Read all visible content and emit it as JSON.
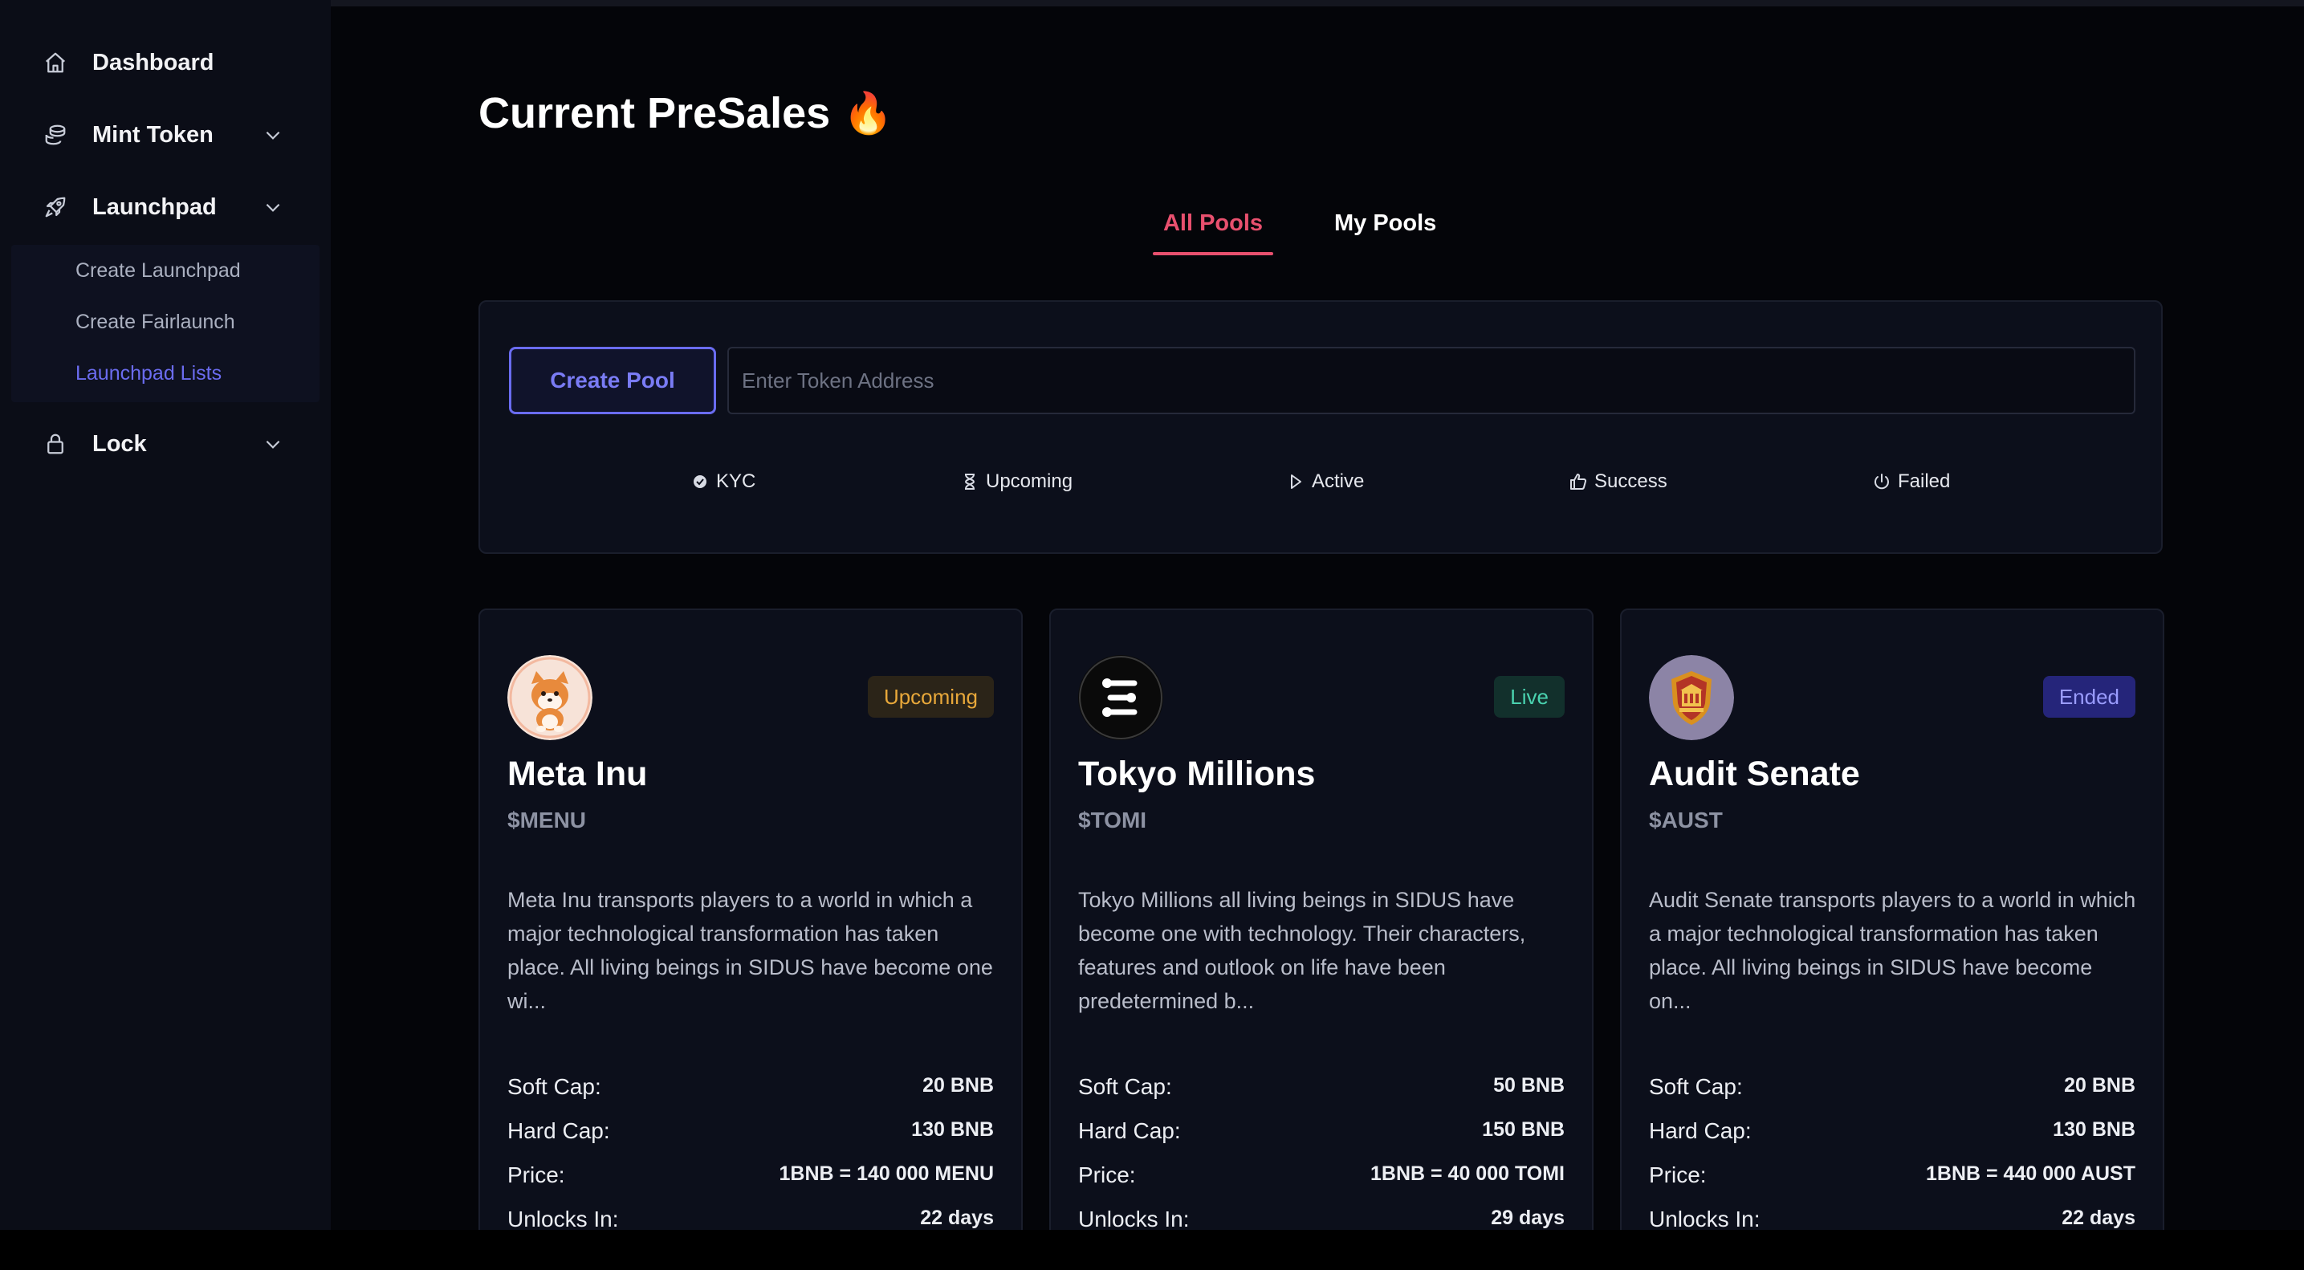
{
  "sidebar": {
    "items": [
      {
        "label": "Dashboard"
      },
      {
        "label": "Mint Token"
      },
      {
        "label": "Launchpad"
      },
      {
        "label": "Lock"
      }
    ],
    "launchpad_submenu": [
      {
        "label": "Create Launchpad"
      },
      {
        "label": "Create Fairlaunch"
      },
      {
        "label": "Launchpad Lists",
        "active": true
      }
    ]
  },
  "page": {
    "title": "Current PreSales",
    "title_emoji": "🔥"
  },
  "tabs": [
    {
      "label": "All Pools",
      "active": true
    },
    {
      "label": "My Pools",
      "active": false
    }
  ],
  "toolbar": {
    "create_pool_label": "Create Pool",
    "token_input_placeholder": "Enter Token Address",
    "token_input_value": ""
  },
  "filters": [
    {
      "label": "KYC",
      "icon": "kyc-icon"
    },
    {
      "label": "Upcoming",
      "icon": "hourglass-icon"
    },
    {
      "label": "Active",
      "icon": "play-icon"
    },
    {
      "label": "Success",
      "icon": "thumbs-up-icon"
    },
    {
      "label": "Failed",
      "icon": "power-icon"
    }
  ],
  "pools": [
    {
      "name": "Meta Inu",
      "symbol": "$MENU",
      "status": "Upcoming",
      "logo_icon": "shiba-logo",
      "description": "Meta Inu transports players to a world in which a major technological transformation has taken place. All living beings in SIDUS have become one wi...",
      "stats": [
        {
          "label": "Soft Cap:",
          "value": "20 BNB"
        },
        {
          "label": "Hard Cap:",
          "value": "130 BNB"
        },
        {
          "label": "Price:",
          "value": "1BNB = 140 000 MENU"
        },
        {
          "label": "Unlocks In:",
          "value": "22 days"
        }
      ]
    },
    {
      "name": "Tokyo Millions",
      "symbol": "$TOMI",
      "status": "Live",
      "logo_icon": "tomi-logo",
      "description": "Tokyo Millions all living beings in SIDUS have become one with technology. Their characters, features and outlook on life have been predetermined b...",
      "stats": [
        {
          "label": "Soft Cap:",
          "value": "50 BNB"
        },
        {
          "label": "Hard Cap:",
          "value": "150 BNB"
        },
        {
          "label": "Price:",
          "value": "1BNB = 40 000 TOMI"
        },
        {
          "label": "Unlocks In:",
          "value": "29 days"
        }
      ]
    },
    {
      "name": "Audit Senate",
      "symbol": "$AUST",
      "status": "Ended",
      "logo_icon": "senate-shield-logo",
      "description": "Audit Senate transports players to a world in which a major technological transformation has taken place. All living beings in SIDUS have become on...",
      "stats": [
        {
          "label": "Soft Cap:",
          "value": "20 BNB"
        },
        {
          "label": "Hard Cap:",
          "value": "130 BNB"
        },
        {
          "label": "Price:",
          "value": "1BNB = 440 000 AUST"
        },
        {
          "label": "Unlocks In:",
          "value": "22 days"
        }
      ]
    }
  ],
  "colors": {
    "accent": "#6a6cf0",
    "tab_active": "#e8506e",
    "upcoming": "#e8a83a",
    "live": "#4ad3b0",
    "ended": "#9a9cff"
  }
}
